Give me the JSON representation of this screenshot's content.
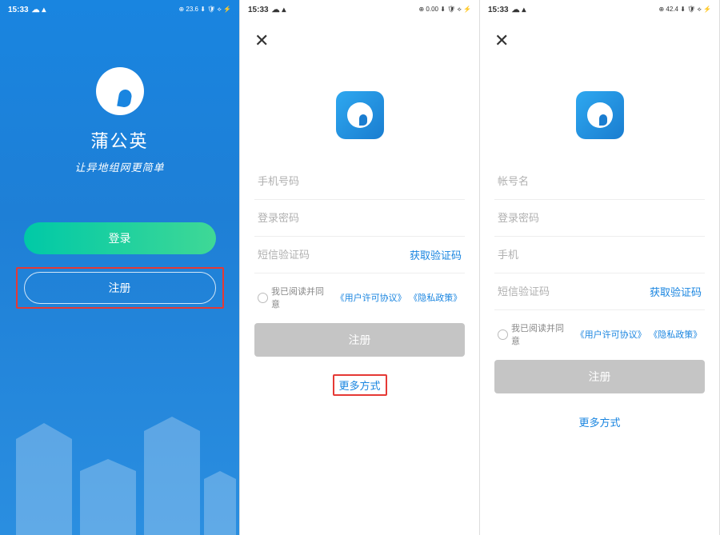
{
  "status": {
    "time": "15:33",
    "icons_left": "☁ ▴",
    "icons_right_1": "⊕ 23.6 ⬇ 🛡 ⟡ ⚡",
    "icons_right_2": "⊕ 0.00 ⬇ 🛡 ⟡ ⚡",
    "icons_right_3": "⊕ 42.4 ⬇ 🛡 ⟡ ⚡"
  },
  "screen1": {
    "app_name": "蒲公英",
    "slogan": "让异地组网更简单",
    "login": "登录",
    "register": "注册"
  },
  "screen2": {
    "ph_phone": "手机号码",
    "ph_password": "登录密码",
    "ph_sms": "短信验证码",
    "get_code": "获取验证码",
    "agree_prefix": "我已阅读并同意",
    "agreement": "《用户许可协议》",
    "privacy": "《隐私政策》",
    "submit": "注册",
    "more": "更多方式"
  },
  "screen3": {
    "ph_account": "帐号名",
    "ph_password": "登录密码",
    "ph_phone": "手机",
    "ph_sms": "短信验证码",
    "get_code": "获取验证码",
    "agree_prefix": "我已阅读并同意",
    "agreement": "《用户许可协议》",
    "privacy": "《隐私政策》",
    "submit": "注册",
    "more": "更多方式"
  }
}
